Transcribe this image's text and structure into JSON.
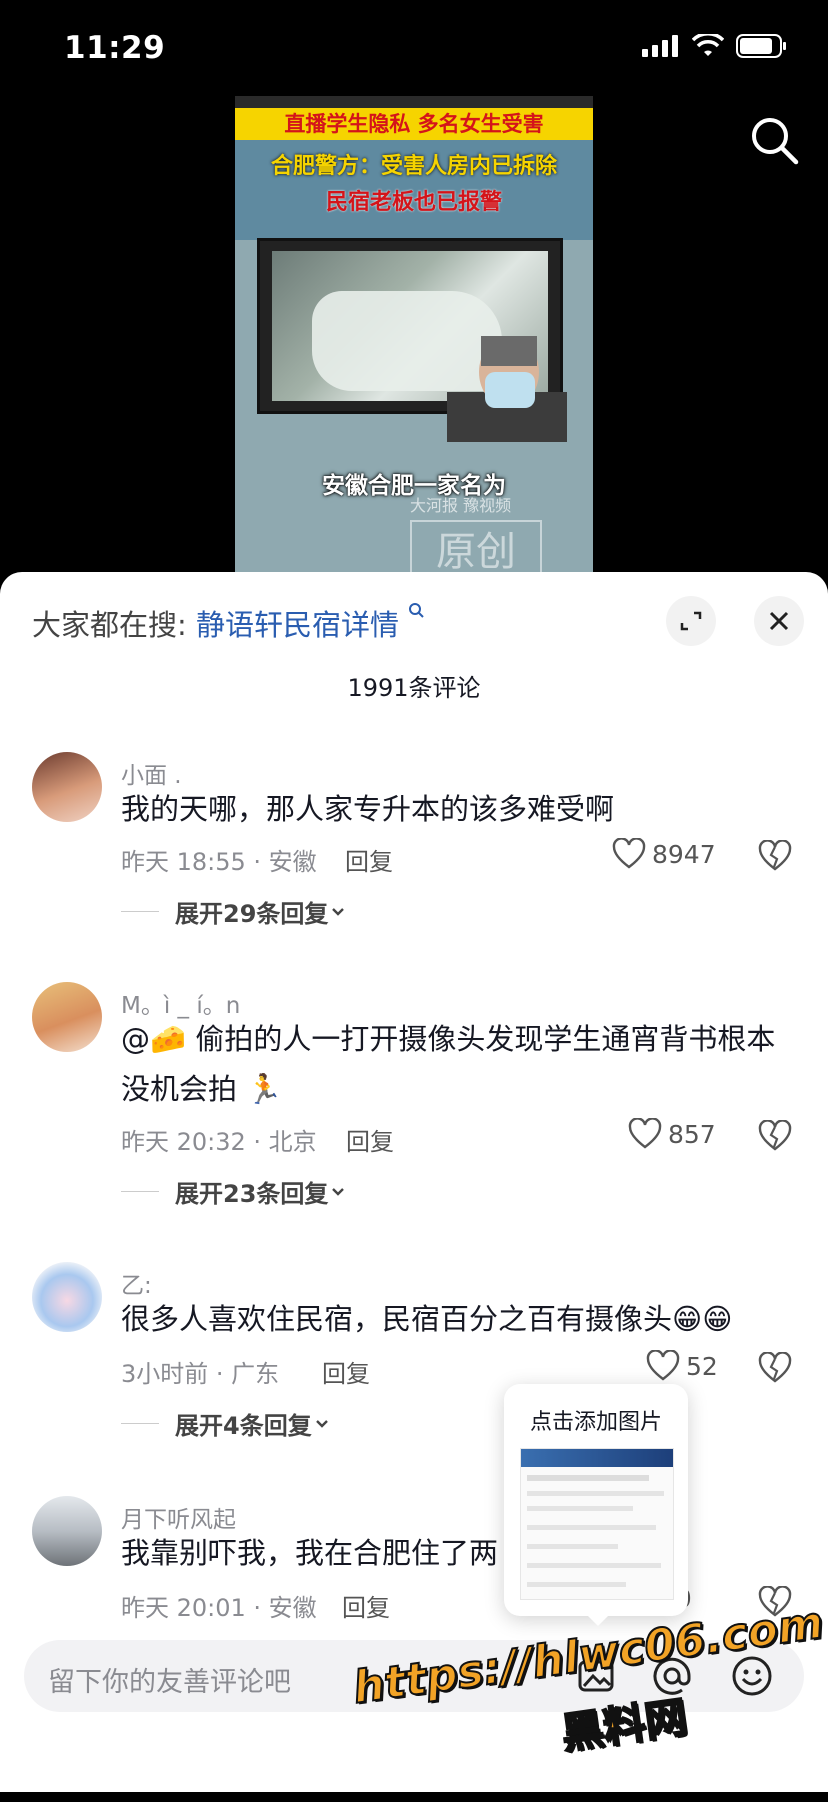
{
  "status_bar": {
    "time": "11:29"
  },
  "video": {
    "banner_line1": "直播学生隐私 多名女生受害",
    "banner_line2": "合肥警方：受害人房内已拆除",
    "banner_line3": "民宿老板也已报警",
    "caption": "安徽合肥一家名为",
    "source_watermark": "大河报 豫视频",
    "original_stamp": "原创"
  },
  "panel": {
    "search_prefix": "大家都在搜:",
    "search_term": "静语轩民宿详情",
    "comment_count": "1991条评论"
  },
  "comments": [
    {
      "name": "小面 .",
      "text": "我的天哪，那人家专升本的该多难受啊",
      "meta": "昨天 18:55 · 安徽",
      "reply": "回复",
      "likes": "8947",
      "expand": "展开29条回复"
    },
    {
      "name": "M。ì _ í。n",
      "text": "@🧀 偷拍的人一打开摄像头发现学生通宵背书根本没机会拍 🏃",
      "meta": "昨天 20:32 · 北京",
      "reply": "回复",
      "likes": "857",
      "expand": "展开23条回复"
    },
    {
      "name": "乙:",
      "text": "很多人喜欢住民宿，民宿百分之百有摄像头😁😁",
      "meta": "3小时前 · 广东",
      "reply": "回复",
      "likes": "52",
      "expand": "展开4条回复"
    },
    {
      "name": "月下听风起",
      "text": "我靠别吓我，我在合肥住了两",
      "meta": "昨天 20:01 · 安徽",
      "reply": "回复",
      "likes": "40"
    }
  ],
  "popup": {
    "title": "点击添加图片"
  },
  "input": {
    "placeholder": "留下你的友善评论吧"
  },
  "watermark": {
    "url": "https://hlwc06.com",
    "site": "黑料网"
  },
  "icons": {
    "search": "search-icon",
    "expand": "expand-icon",
    "close": "close-icon",
    "heart": "heart-icon",
    "broken_heart": "broken-heart-icon",
    "chevron": "chevron-down-icon",
    "image": "image-icon",
    "at": "at-icon",
    "emoji": "emoji-icon"
  },
  "colors": {
    "link_blue": "#2a5db0",
    "watermark_orange": "#f2a326",
    "banner_yellow": "#f6d400",
    "banner_red": "#d4141a"
  }
}
